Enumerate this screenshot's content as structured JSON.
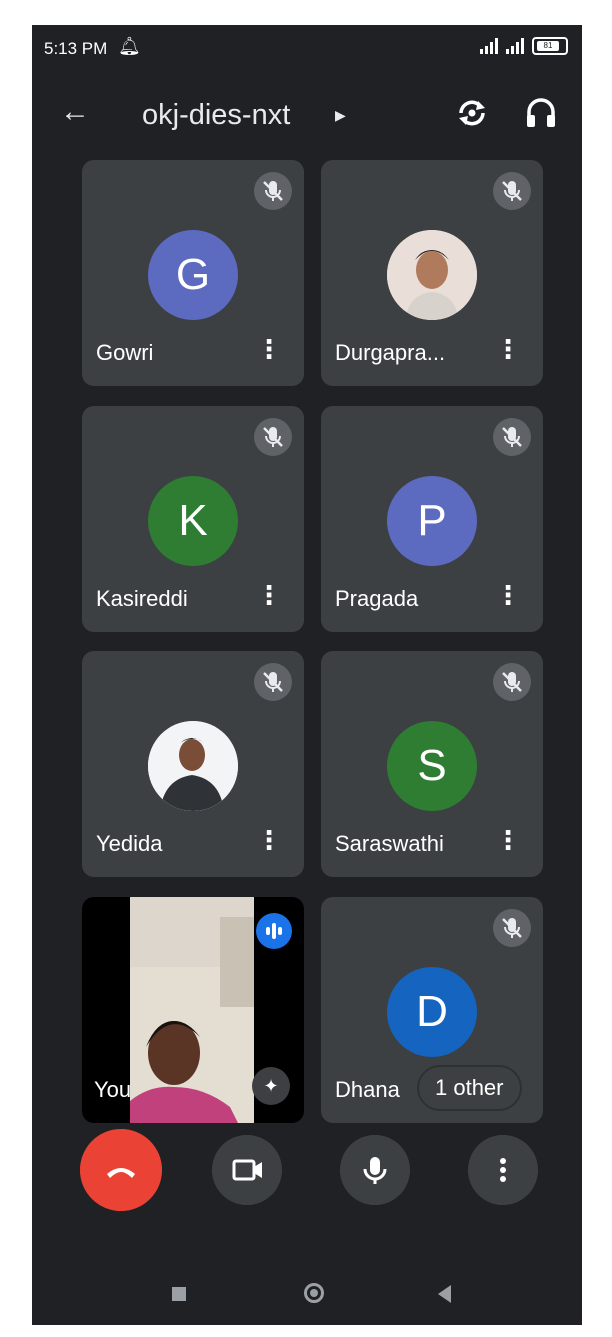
{
  "status_bar": {
    "time": "5:13 PM",
    "battery": "81"
  },
  "header": {
    "meeting_code": "okj-dies-nxt"
  },
  "participants": [
    {
      "name": "Gowri",
      "initial": "G",
      "avatar_color": "#5c6bc0",
      "muted": true
    },
    {
      "name": "Durgapra...",
      "initial": "",
      "avatar_type": "photo",
      "muted": true
    },
    {
      "name": "Kasireddi",
      "initial": "K",
      "avatar_color": "#2e7d32",
      "muted": true
    },
    {
      "name": "Pragada",
      "initial": "P",
      "avatar_color": "#5c6bc0",
      "muted": true
    },
    {
      "name": "Yedida",
      "initial": "",
      "avatar_type": "photo",
      "muted": true
    },
    {
      "name": "Saraswathi",
      "initial": "S",
      "avatar_color": "#2e7d32",
      "muted": true
    },
    {
      "name": "You",
      "self": true,
      "speaking": true
    },
    {
      "name": "Dhana",
      "initial": "D",
      "avatar_color": "#1565c0",
      "muted": true,
      "chip": "1 other"
    }
  ],
  "controls": [
    "end-call",
    "camera",
    "microphone",
    "more-options"
  ],
  "colors": {
    "background": "#202124",
    "tile": "#3c4043",
    "end_call": "#ea4335",
    "speaking": "#1a73e8"
  }
}
